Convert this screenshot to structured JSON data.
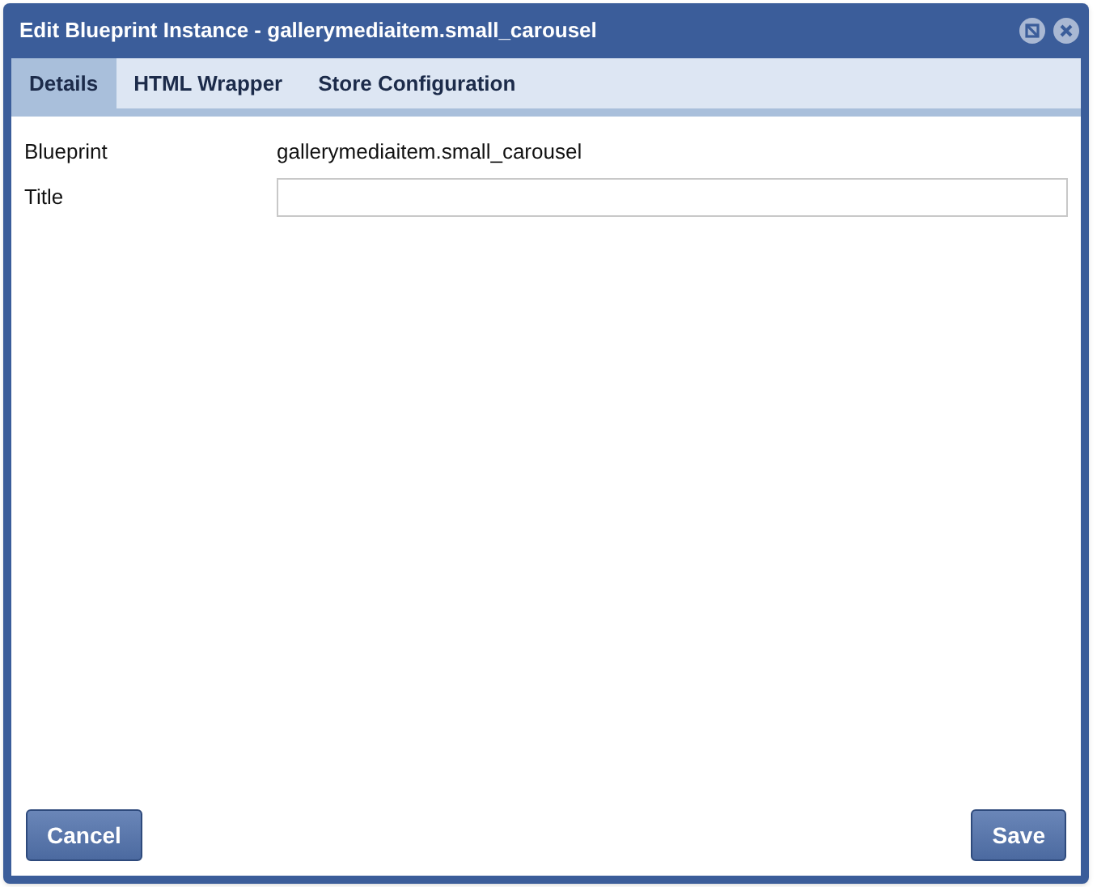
{
  "window": {
    "title": "Edit Blueprint Instance - gallerymediaitem.small_carousel"
  },
  "tabs": [
    {
      "label": "Details",
      "selected": true
    },
    {
      "label": "HTML Wrapper",
      "selected": false
    },
    {
      "label": "Store Configuration",
      "selected": false
    }
  ],
  "fields": [
    {
      "kind": "text",
      "label": "Blueprint",
      "value": "gallerymediaitem.small_carousel"
    },
    {
      "kind": "input",
      "label": "Title"
    }
  ],
  "buttons": [
    {
      "label": "Cancel"
    },
    {
      "label": "Save"
    }
  ]
}
